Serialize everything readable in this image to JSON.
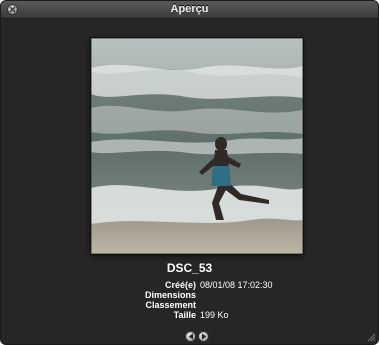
{
  "window": {
    "title": "Aperçu"
  },
  "photo": {
    "filename": "DSC_53"
  },
  "metadata": [
    {
      "label": "Créé(e)",
      "value": "08/01/08 17:02:30"
    },
    {
      "label": "Dimensions",
      "value": ""
    },
    {
      "label": "Classement",
      "value": ""
    },
    {
      "label": "Taille",
      "value": "199 Ko"
    }
  ],
  "icons": {
    "close": "close-icon",
    "prev": "previous-arrow-icon",
    "next": "next-arrow-icon"
  }
}
